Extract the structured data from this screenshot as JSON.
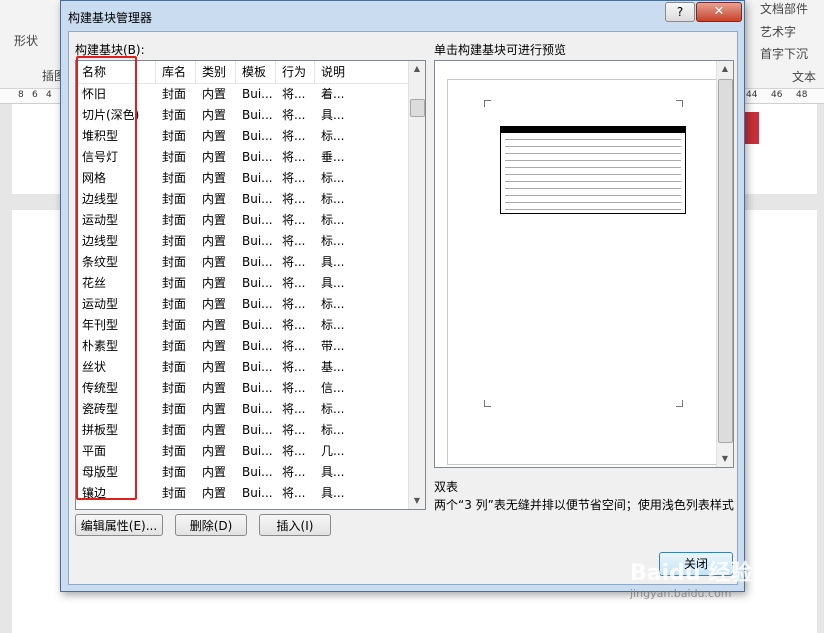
{
  "background": {
    "ribbon_left_label": "形状",
    "ribbon_left_sub": "插图",
    "ribbon_right_items": [
      "文档部件",
      "艺术字",
      "首字下沉"
    ],
    "ribbon_right_group": "文本",
    "ruler_left": [
      "8",
      "6",
      "4"
    ],
    "ruler_right": [
      "44",
      "46",
      "48"
    ]
  },
  "dialog": {
    "title": "构建基块管理器",
    "help_label": "?",
    "close_label": "✕",
    "list_label": "构建基块(B):",
    "preview_label": "单击构建基块可进行预览",
    "columns": [
      "名称",
      "库名",
      "类别",
      "模板",
      "行为",
      "说明"
    ],
    "rows": [
      [
        "怀旧",
        "封面",
        "内置",
        "Bui...",
        "将...",
        "着..."
      ],
      [
        "切片(深色)",
        "封面",
        "内置",
        "Bui...",
        "将...",
        "具..."
      ],
      [
        "堆积型",
        "封面",
        "内置",
        "Bui...",
        "将...",
        "标..."
      ],
      [
        "信号灯",
        "封面",
        "内置",
        "Bui...",
        "将...",
        "垂..."
      ],
      [
        "网格",
        "封面",
        "内置",
        "Bui...",
        "将...",
        "标..."
      ],
      [
        "边线型",
        "封面",
        "内置",
        "Bui...",
        "将...",
        "标..."
      ],
      [
        "运动型",
        "封面",
        "内置",
        "Bui...",
        "将...",
        "标..."
      ],
      [
        "边线型",
        "封面",
        "内置",
        "Bui...",
        "将...",
        "标..."
      ],
      [
        "条纹型",
        "封面",
        "内置",
        "Bui...",
        "将...",
        "具..."
      ],
      [
        "花丝",
        "封面",
        "内置",
        "Bui...",
        "将...",
        "具..."
      ],
      [
        "运动型",
        "封面",
        "内置",
        "Bui...",
        "将...",
        "标..."
      ],
      [
        "年刊型",
        "封面",
        "内置",
        "Bui...",
        "将...",
        "标..."
      ],
      [
        "朴素型",
        "封面",
        "内置",
        "Bui...",
        "将...",
        "带..."
      ],
      [
        "丝状",
        "封面",
        "内置",
        "Bui...",
        "将...",
        "基..."
      ],
      [
        "传统型",
        "封面",
        "内置",
        "Bui...",
        "将...",
        "信..."
      ],
      [
        "瓷砖型",
        "封面",
        "内置",
        "Bui...",
        "将...",
        "标..."
      ],
      [
        "拼板型",
        "封面",
        "内置",
        "Bui...",
        "将...",
        "标..."
      ],
      [
        "平面",
        "封面",
        "内置",
        "Bui...",
        "将...",
        "几..."
      ],
      [
        "母版型",
        "封面",
        "内置",
        "Bui...",
        "将...",
        "具..."
      ],
      [
        "镶边",
        "封面",
        "内置",
        "Bui...",
        "将...",
        "具..."
      ]
    ],
    "preview_name": "双表",
    "preview_description": "两个“3 列”表无缝并排以便节省空间；使用浅色列表样式",
    "buttons": {
      "edit": "编辑属性(E)...",
      "delete": "删除(D)",
      "insert": "插入(I)",
      "close": "关闭"
    }
  },
  "watermark": {
    "main": "Baidu 经验",
    "sub": "jingyan.baidu.com"
  },
  "colors": {
    "highlight_box": "#e02020",
    "dialog_frame": "#c9dcf0"
  }
}
